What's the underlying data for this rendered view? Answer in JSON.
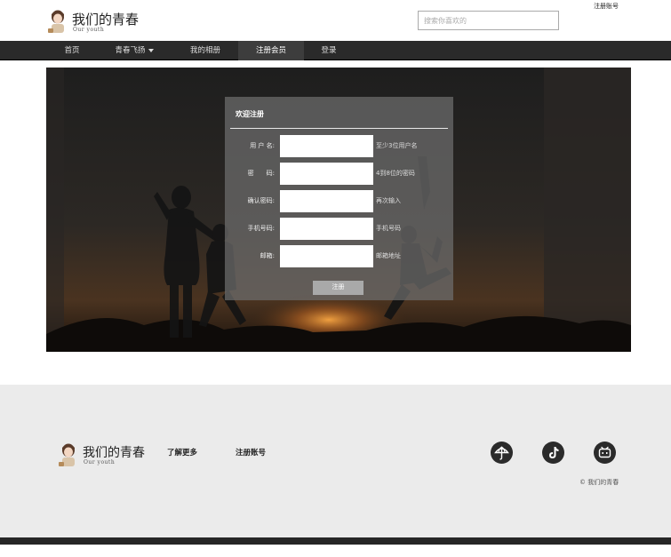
{
  "brand": {
    "title": "我们的青春",
    "subtitle": "Our youth"
  },
  "header": {
    "search_placeholder": "搜索你喜欢的",
    "top_link": "注册账号"
  },
  "nav": {
    "items": [
      {
        "label": "首页"
      },
      {
        "label": "青春飞扬",
        "has_dropdown": true
      },
      {
        "label": "我的相册"
      },
      {
        "label": "注册会员",
        "active": true
      },
      {
        "label": "登录"
      }
    ]
  },
  "form": {
    "title": "欢迎注册",
    "fields": [
      {
        "label": "用 户 名:",
        "value": "",
        "hint": "至少3位用户名"
      },
      {
        "label": "密　　码:",
        "value": "",
        "hint": "4到8位的密码"
      },
      {
        "label": "确认密码:",
        "value": "",
        "hint": "再次输入"
      },
      {
        "label": "手机号码:",
        "value": "",
        "hint": "手机号码"
      },
      {
        "label": "邮箱:",
        "value": "",
        "hint": "邮箱地址"
      }
    ],
    "submit_label": "注册"
  },
  "footer": {
    "links": [
      {
        "label": "了解更多"
      },
      {
        "label": "注册账号"
      }
    ],
    "social_icons": [
      "umbrella-icon",
      "tiktok-icon",
      "bilibili-icon"
    ],
    "copyright": "© 我们的青春"
  },
  "colors": {
    "nav_bg": "#2a2a2a",
    "footer_bg": "#ebebeb",
    "panel_bg": "#6e6e6e",
    "bottom_bar": "#262626"
  }
}
